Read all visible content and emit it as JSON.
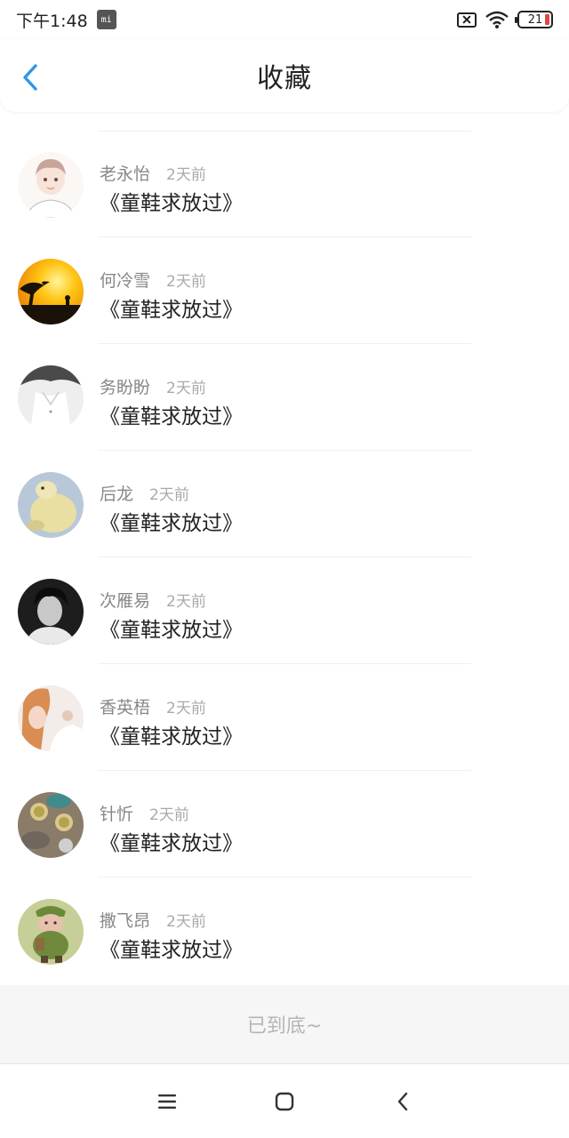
{
  "status": {
    "time": "下午1:48",
    "battery": "21"
  },
  "header": {
    "title": "收藏"
  },
  "items": [
    {
      "name": "老永怡",
      "time": "2天前",
      "title": "《童鞋求放过》",
      "avatar": "avatar-cartoon-boy"
    },
    {
      "name": "何冷雪",
      "time": "2天前",
      "title": "《童鞋求放过》",
      "avatar": "avatar-sunset-tree"
    },
    {
      "name": "务盼盼",
      "time": "2天前",
      "title": "《童鞋求放过》",
      "avatar": "avatar-white-shirt"
    },
    {
      "name": "后龙",
      "time": "2天前",
      "title": "《童鞋求放过》",
      "avatar": "avatar-animal"
    },
    {
      "name": "次雁易",
      "time": "2天前",
      "title": "《童鞋求放过》",
      "avatar": "avatar-bw-man"
    },
    {
      "name": "香英梧",
      "time": "2天前",
      "title": "《童鞋求放过》",
      "avatar": "avatar-girl"
    },
    {
      "name": "针忻",
      "time": "2天前",
      "title": "《童鞋求放过》",
      "avatar": "avatar-tea"
    },
    {
      "name": "撒飞昂",
      "time": "2天前",
      "title": "《童鞋求放过》",
      "avatar": "avatar-cartoon-pig"
    }
  ],
  "footer": {
    "end_text": "已到底~"
  },
  "colors": {
    "accent": "#2f95e8",
    "name": "#888888",
    "time": "#aaaaaa",
    "end_bg": "#f6f6f6"
  }
}
